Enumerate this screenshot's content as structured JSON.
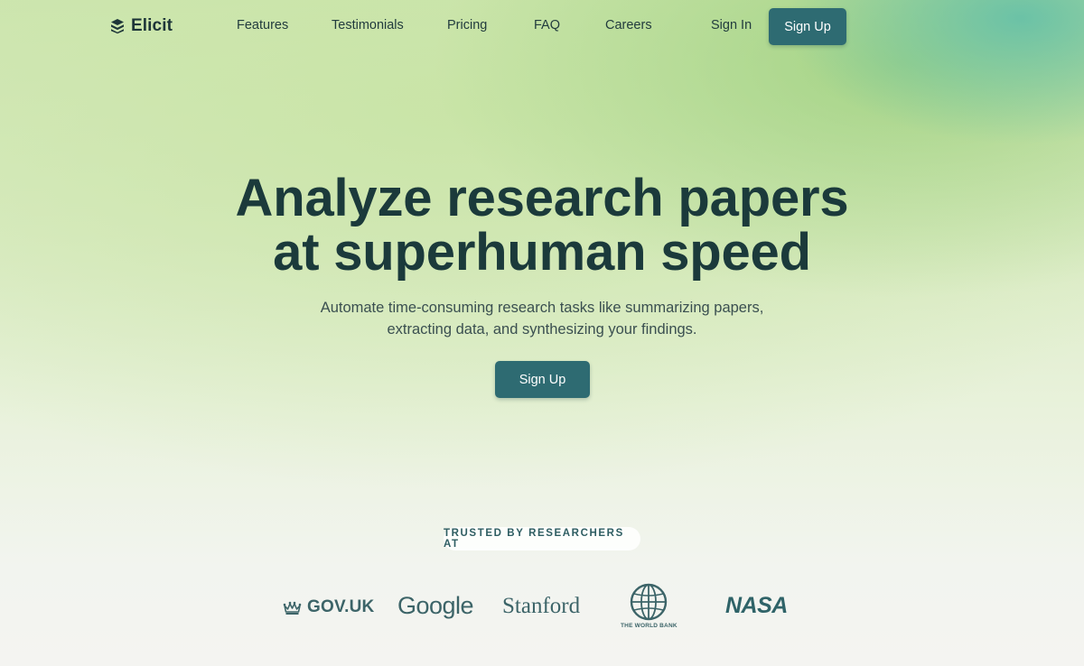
{
  "brand": {
    "name": "Elicit",
    "icon": "elicit-logo-icon"
  },
  "nav": {
    "links": [
      "Features",
      "Testimonials",
      "Pricing",
      "FAQ",
      "Careers"
    ],
    "sign_in": "Sign In",
    "sign_up": "Sign Up"
  },
  "hero": {
    "title_line1": "Analyze research papers",
    "title_line2": "at superhuman speed",
    "subtitle_line1": "Automate time-consuming research tasks like summarizing papers,",
    "subtitle_line2": "extracting data, and synthesizing your findings.",
    "cta": "Sign Up"
  },
  "trusted": {
    "label": "TRUSTED BY RESEARCHERS AT",
    "orgs": [
      {
        "name": "GOV.UK",
        "icon": "crown-icon"
      },
      {
        "name": "Google"
      },
      {
        "name": "Stanford"
      },
      {
        "name": "THE WORLD BANK",
        "icon": "globe-icon"
      },
      {
        "name": "NASA"
      }
    ]
  },
  "colors": {
    "primary": "#2e6b72",
    "heading": "#1b3a3b",
    "logo_tint": "#3c6468"
  }
}
